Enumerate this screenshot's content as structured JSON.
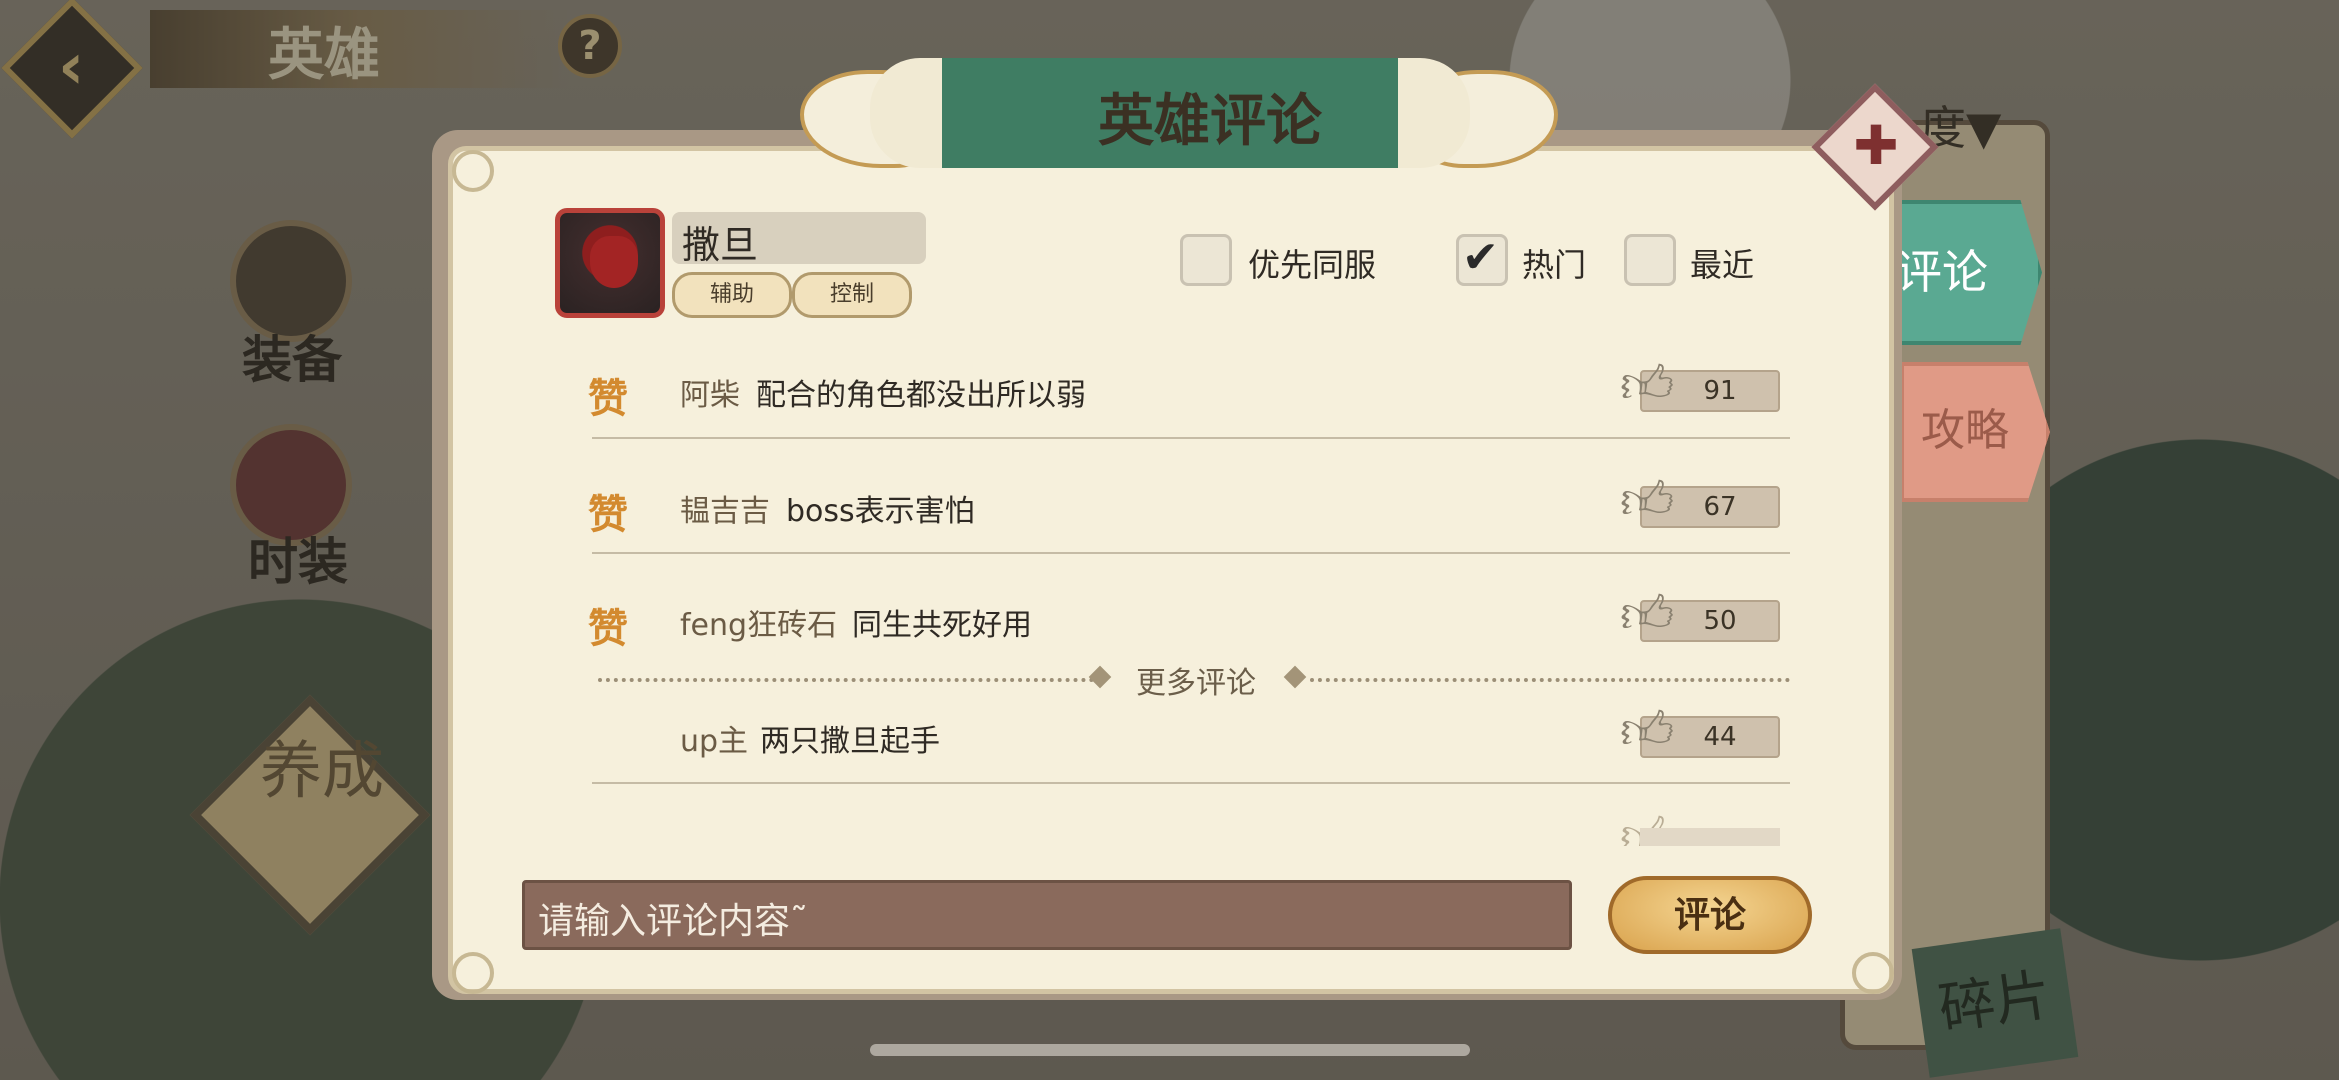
{
  "background": {
    "hero_title": "英雄",
    "help_label": "?",
    "equip_label": "装备",
    "skin_label": "时装",
    "develop_label": "养成",
    "sort_label": "度▼",
    "fragments_label": "碎片"
  },
  "modal": {
    "title": "英雄评论",
    "close_label": "✚"
  },
  "hero": {
    "name": "撒旦",
    "tags": [
      "辅助",
      "控制"
    ]
  },
  "filters": [
    {
      "label": "优先同服",
      "checked": false
    },
    {
      "label": "热门",
      "checked": true
    },
    {
      "label": "最近",
      "checked": false
    }
  ],
  "side_tabs": {
    "comment": "评论",
    "guide": "攻略"
  },
  "praise_badge": "赞",
  "comments_top": [
    {
      "user": "阿柴",
      "text": "配合的角色都没出所以弱",
      "likes": "91"
    },
    {
      "user": "韫吉吉",
      "text": "boss表示害怕",
      "likes": "67"
    },
    {
      "user": "feng狂砖石",
      "text": "同生共死好用",
      "likes": "50"
    }
  ],
  "more_label": "更多评论",
  "comments_more": [
    {
      "user": "up主",
      "text": "两只撒旦起手",
      "likes": "44"
    }
  ],
  "input": {
    "placeholder": "请输入评论内容˜"
  },
  "submit_label": "评论"
}
